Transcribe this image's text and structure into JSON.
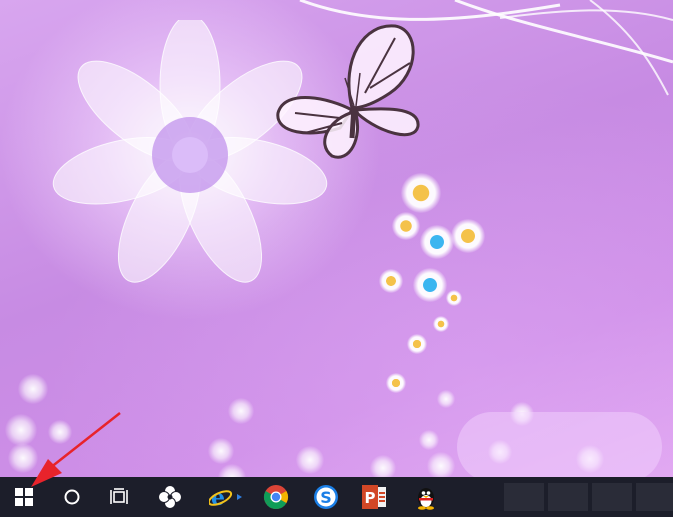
{
  "desktop": {
    "wallpaper": "purple-floral-butterfly",
    "colors": {
      "base": "#c98de6",
      "taskbar": "#1c1e2a",
      "annotation_arrow": "#e8232b"
    }
  },
  "taskbar": {
    "items": [
      {
        "name": "start-button",
        "icon": "windows-logo-icon"
      },
      {
        "name": "search-button",
        "icon": "cortana-circle-icon"
      },
      {
        "name": "task-view-button",
        "icon": "task-view-icon"
      },
      {
        "name": "app-pinwheel",
        "icon": "pinwheel-icon"
      },
      {
        "name": "app-internet-explorer",
        "icon": "internet-explorer-icon"
      },
      {
        "name": "app-chrome",
        "icon": "chrome-icon"
      },
      {
        "name": "app-sogou-browser",
        "icon": "sogou-s-icon"
      },
      {
        "name": "app-powerpoint",
        "icon": "powerpoint-icon"
      },
      {
        "name": "app-qq",
        "icon": "qq-penguin-icon"
      }
    ]
  }
}
